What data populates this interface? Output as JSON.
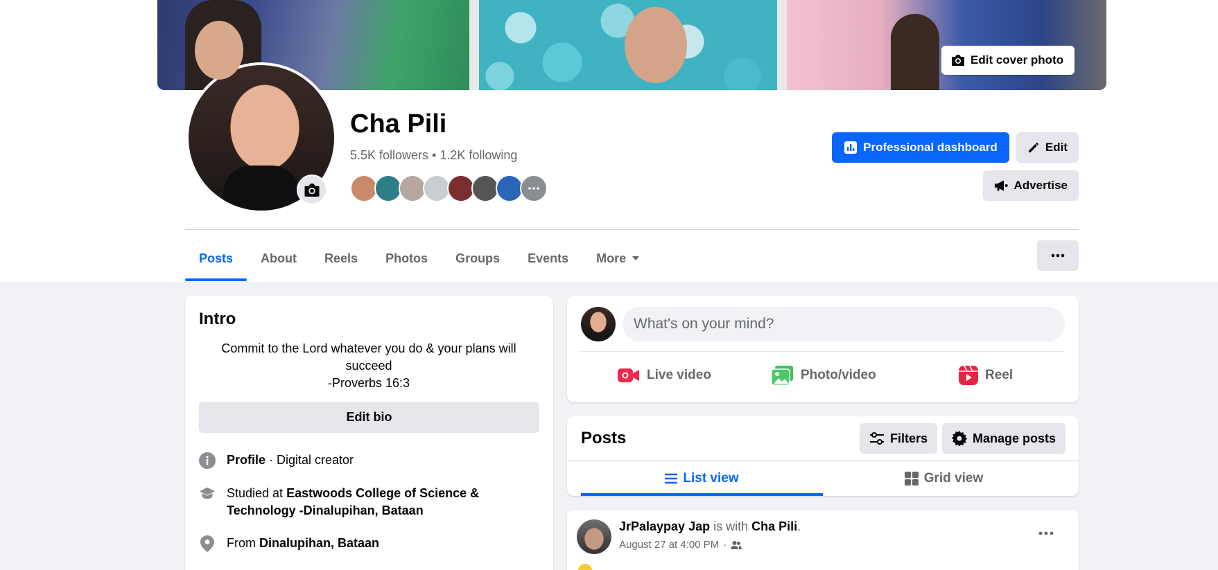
{
  "profile": {
    "name": "Cha Pili",
    "stats": "5.5K followers • 1.2K following",
    "edit_cover_label": "Edit cover photo"
  },
  "friend_avatar_colors": [
    "#c98a6a",
    "#2d7e86",
    "#b6a7a0",
    "#c9ccd1",
    "#7a2e2e",
    "#555555",
    "#2a66b8",
    "#8a8d91"
  ],
  "header_actions": {
    "professional_dashboard": "Professional dashboard",
    "edit": "Edit",
    "advertise": "Advertise"
  },
  "tabs": [
    {
      "label": "Posts",
      "active": true
    },
    {
      "label": "About"
    },
    {
      "label": "Reels"
    },
    {
      "label": "Photos"
    },
    {
      "label": "Groups"
    },
    {
      "label": "Events"
    },
    {
      "label": "More"
    }
  ],
  "intro": {
    "title": "Intro",
    "bio_line1": "Commit to the Lord whatever you do & your plans will",
    "bio_line2": "succeed",
    "bio_line3": "-Proverbs 16:3",
    "edit_bio": "Edit bio",
    "profile_label": "Profile",
    "profile_value": " · Digital creator",
    "studied_prefix": "Studied at ",
    "studied_school": "Eastwoods College of Science & Technology -Dinalupihan, Bataan",
    "from_prefix": "From ",
    "from_place": "Dinalupihan, Bataan"
  },
  "composer": {
    "placeholder": "What's on your mind?",
    "live_video": "Live video",
    "photo_video": "Photo/video",
    "reel": "Reel"
  },
  "posts_section": {
    "title": "Posts",
    "filters": "Filters",
    "manage_posts": "Manage posts",
    "list_view": "List view",
    "grid_view": "Grid view"
  },
  "post": {
    "author": "JrPalaypay Jap",
    "with_text": " is with ",
    "tagged": "Cha Pili",
    "period": ".",
    "timestamp": "August 27 at 4:00 PM",
    "separator": "·"
  },
  "colors": {
    "accent": "#0866ff",
    "live_red": "#f02849",
    "photo_green": "#45bd62",
    "reel_pink": "#e42645"
  }
}
